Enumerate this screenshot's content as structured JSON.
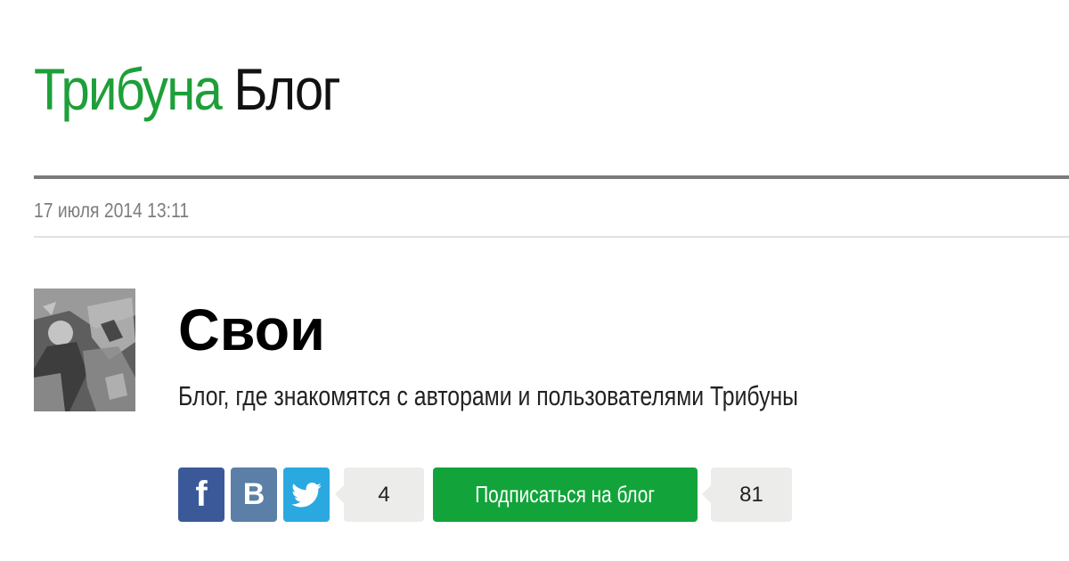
{
  "header": {
    "brand_primary": "Трибуна",
    "brand_secondary": " Блог"
  },
  "post": {
    "date": "17 июля 2014 13:11"
  },
  "blog": {
    "title": "Свои",
    "description": "Блог, где знакомятся с авторами и пользователями Трибуны"
  },
  "share": {
    "facebook_glyph": "f",
    "vk_glyph": "B",
    "twitter_icon": "twitter-bird-icon",
    "count": "4"
  },
  "subscribe": {
    "label": "Подписаться на блог",
    "count": "81"
  },
  "colors": {
    "brand_green": "#1e9f39",
    "subscribe_green": "#12a43a",
    "facebook_blue": "#3b5998",
    "vk_blue": "#5b7fa6",
    "twitter_blue": "#2aa9e0",
    "count_bg": "#ececea"
  }
}
